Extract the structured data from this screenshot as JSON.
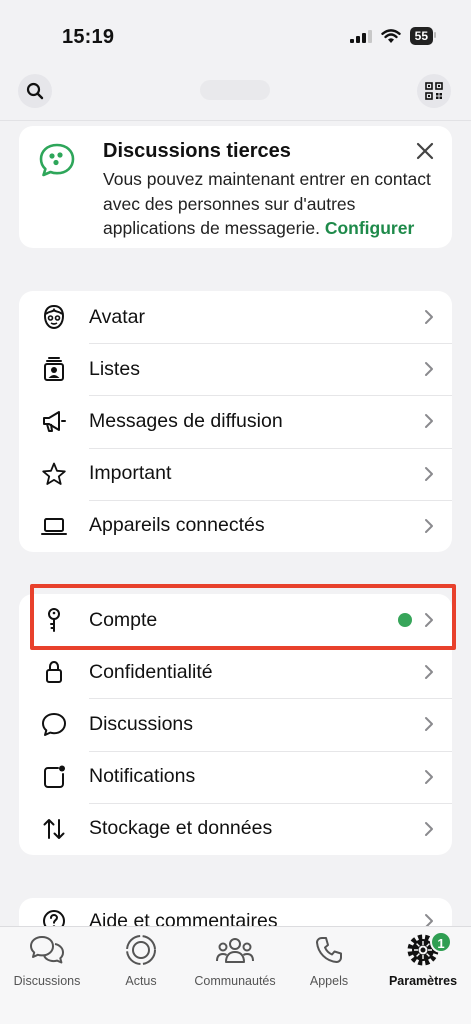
{
  "status_bar": {
    "time": "15:19",
    "battery": "55"
  },
  "banner": {
    "title": "Discussions tierces",
    "text": "Vous pouvez maintenant entrer en contact avec des personnes sur d'autres applications de messagerie.",
    "link": "Configurer",
    "accent_color": "#1e8a4a"
  },
  "card1": {
    "items": [
      {
        "label": "Avatar",
        "icon": "avatar-icon"
      },
      {
        "label": "Listes",
        "icon": "lists-icon"
      },
      {
        "label": "Messages de diffusion",
        "icon": "megaphone-icon"
      },
      {
        "label": "Important",
        "icon": "star-icon"
      },
      {
        "label": "Appareils connectés",
        "icon": "laptop-icon"
      }
    ]
  },
  "card2": {
    "items": [
      {
        "label": "Compte",
        "icon": "key-icon",
        "has_dot": true
      },
      {
        "label": "Confidentialité",
        "icon": "lock-icon"
      },
      {
        "label": "Discussions",
        "icon": "chat-bubble-icon"
      },
      {
        "label": "Notifications",
        "icon": "notification-icon"
      },
      {
        "label": "Stockage et données",
        "icon": "arrows-updown-icon"
      }
    ]
  },
  "card3": {
    "items": [
      {
        "label": "Aide et commentaires",
        "icon": "help-icon"
      }
    ]
  },
  "tabs": [
    {
      "label": "Discussions",
      "icon": "chats-icon"
    },
    {
      "label": "Actus",
      "icon": "updates-icon"
    },
    {
      "label": "Communautés",
      "icon": "communities-icon"
    },
    {
      "label": "Appels",
      "icon": "phone-icon"
    },
    {
      "label": "Paramètres",
      "icon": "settings-icon",
      "active": true,
      "badge": "1"
    }
  ],
  "colors": {
    "highlight": "#e8412c",
    "status_dot": "#37a55a",
    "badge": "#2f9e52"
  }
}
